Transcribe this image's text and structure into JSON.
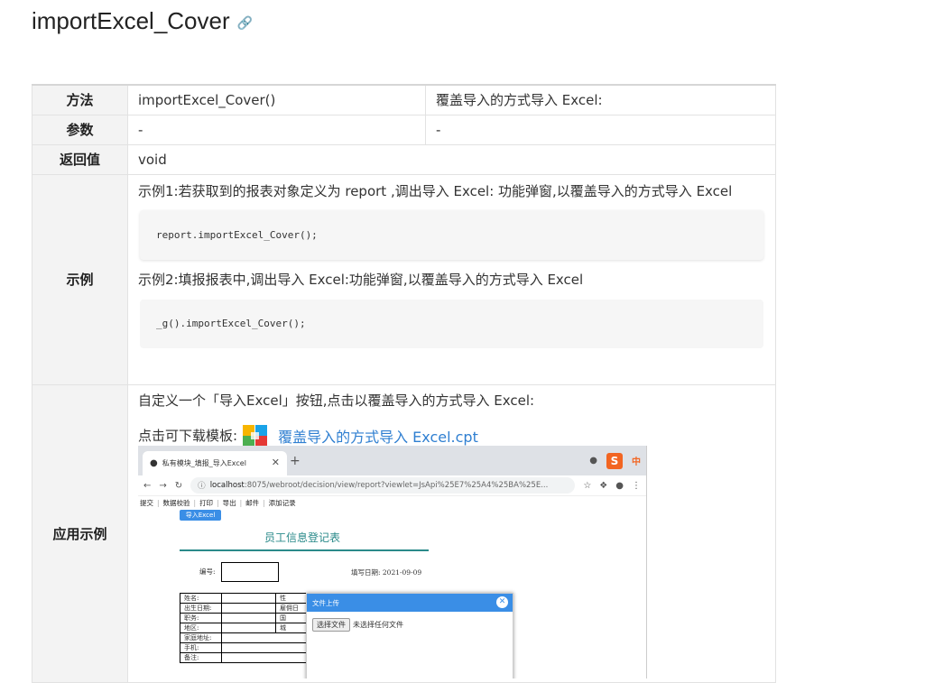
{
  "page": {
    "title": "importExcel_Cover"
  },
  "table": {
    "method_label": "方法",
    "method_name": "importExcel_Cover()",
    "method_desc": "覆盖导入的方式导入 Excel:",
    "param_label": "参数",
    "param_v1": "-",
    "param_v2": "-",
    "return_label": "返回值",
    "return_value": "void",
    "example_label": "示例",
    "example1_text": "示例1:若获取到的报表对象定义为 report ,调出导入 Excel: 功能弹窗,以覆盖导入的方式导入 Excel",
    "example1_code": "report.importExcel_Cover();",
    "example2_text": "示例2:填报报表中,调出导入 Excel:功能弹窗,以覆盖导入的方式导入 Excel",
    "example2_code": "_g().importExcel_Cover();",
    "app_label": "应用示例",
    "app_text": "自定义一个「导入Excel」按钮,点击以覆盖导入的方式导入 Excel:",
    "download_prefix": "点击可下载模板:",
    "download_link": "覆盖导入的方式导入 Excel.cpt"
  },
  "screenshot": {
    "tab_title": "私有模块_填报_导入Excel",
    "url_host": "localhost",
    "url_rest": ":8075/webroot/decision/view/report?viewlet=JsApi%25E7%25A4%25BA%25E...",
    "toolbar": [
      "提交",
      "数据校验",
      "打印",
      "导出",
      "邮件",
      "添加记录"
    ],
    "import_button": "导入Excel",
    "form_title": "员工信息登记表",
    "num_label": "编号:",
    "date_label": "填写日期: 2021-09-09",
    "grid_rows": [
      "姓名:",
      "出生日期:",
      "职务:",
      "地区:",
      "家庭地址:",
      "手机:",
      "备注:"
    ],
    "grid_right": [
      "性",
      "雇佣日",
      "国",
      "城"
    ],
    "dialog_title": "文件上传",
    "choose_button": "选择文件",
    "no_file": "未选择任何文件",
    "ime_label": "中"
  }
}
